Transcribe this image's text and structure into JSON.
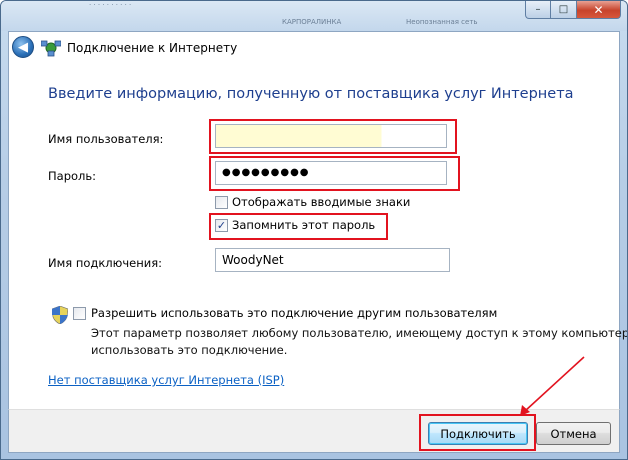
{
  "window": {
    "title": "Подключение к Интернету",
    "caption_buttons": {
      "minimize": "–",
      "maximize": "□",
      "close": "✕"
    },
    "background_ghost_text": [
      "КАРПОРАЛИНКА",
      "Неопознанная сеть"
    ]
  },
  "header": {
    "back_icon": "back-arrow-icon",
    "network_icon": "network-connection-icon"
  },
  "form": {
    "instruction": "Введите информацию, полученную от поставщика услуг Интернета",
    "username": {
      "label": "Имя пользователя:",
      "value": ""
    },
    "password": {
      "label": "Пароль:",
      "value": "●●●●●●●●●"
    },
    "show_chars": {
      "label": "Отображать вводимые знаки",
      "checked": false
    },
    "remember_password": {
      "label": "Запомнить этот пароль",
      "checked": true,
      "mark": "✓"
    },
    "connection_name": {
      "label": "Имя подключения:",
      "value": "WoodyNet"
    },
    "allow_others": {
      "label": "Разрешить использовать это подключение другим пользователям",
      "checked": false,
      "description_line1": "Этот параметр позволяет любому пользователю, имеющему доступ к этому компьютеру,",
      "description_line2": "использовать это подключение."
    },
    "isp_link": "Нет поставщика услуг Интернета (ISP)"
  },
  "footer": {
    "connect_button": "Подключить",
    "cancel_button": "Отмена"
  },
  "colors": {
    "annotation_red": "#e2131f",
    "instruction_blue": "#1e3f8f",
    "link_blue": "#0b61c4",
    "username_highlight": "#fffcd3"
  }
}
